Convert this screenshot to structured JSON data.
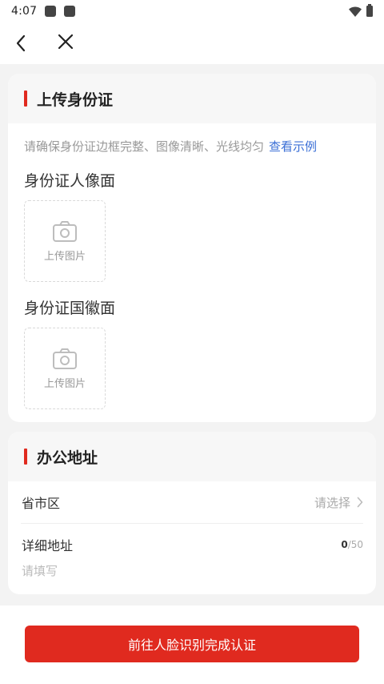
{
  "status_bar": {
    "time": "4:07",
    "icons": [
      "notification-icon",
      "notification-icon",
      "wifi-icon",
      "battery-icon"
    ]
  },
  "nav": {
    "back_icon": "chevron-left-icon",
    "close_icon": "close-icon"
  },
  "id_section": {
    "title": "上传身份证",
    "hint": "请确保身份证边框完整、图像清晰、光线均匀",
    "example_link": "查看示例",
    "front": {
      "label": "身份证人像面",
      "upload_text": "上传图片"
    },
    "back": {
      "label": "身份证国徽面",
      "upload_text": "上传图片"
    }
  },
  "address_section": {
    "title": "办公地址",
    "region": {
      "label": "省市区",
      "placeholder": "请选择"
    },
    "detail": {
      "label": "详细地址",
      "count": "0",
      "max": "/50",
      "placeholder": "请填写"
    }
  },
  "submit_label": "前往人脸识别完成认证",
  "colors": {
    "accent": "#e02a1f",
    "link": "#3b6fd6",
    "background": "#f3f3f3"
  }
}
